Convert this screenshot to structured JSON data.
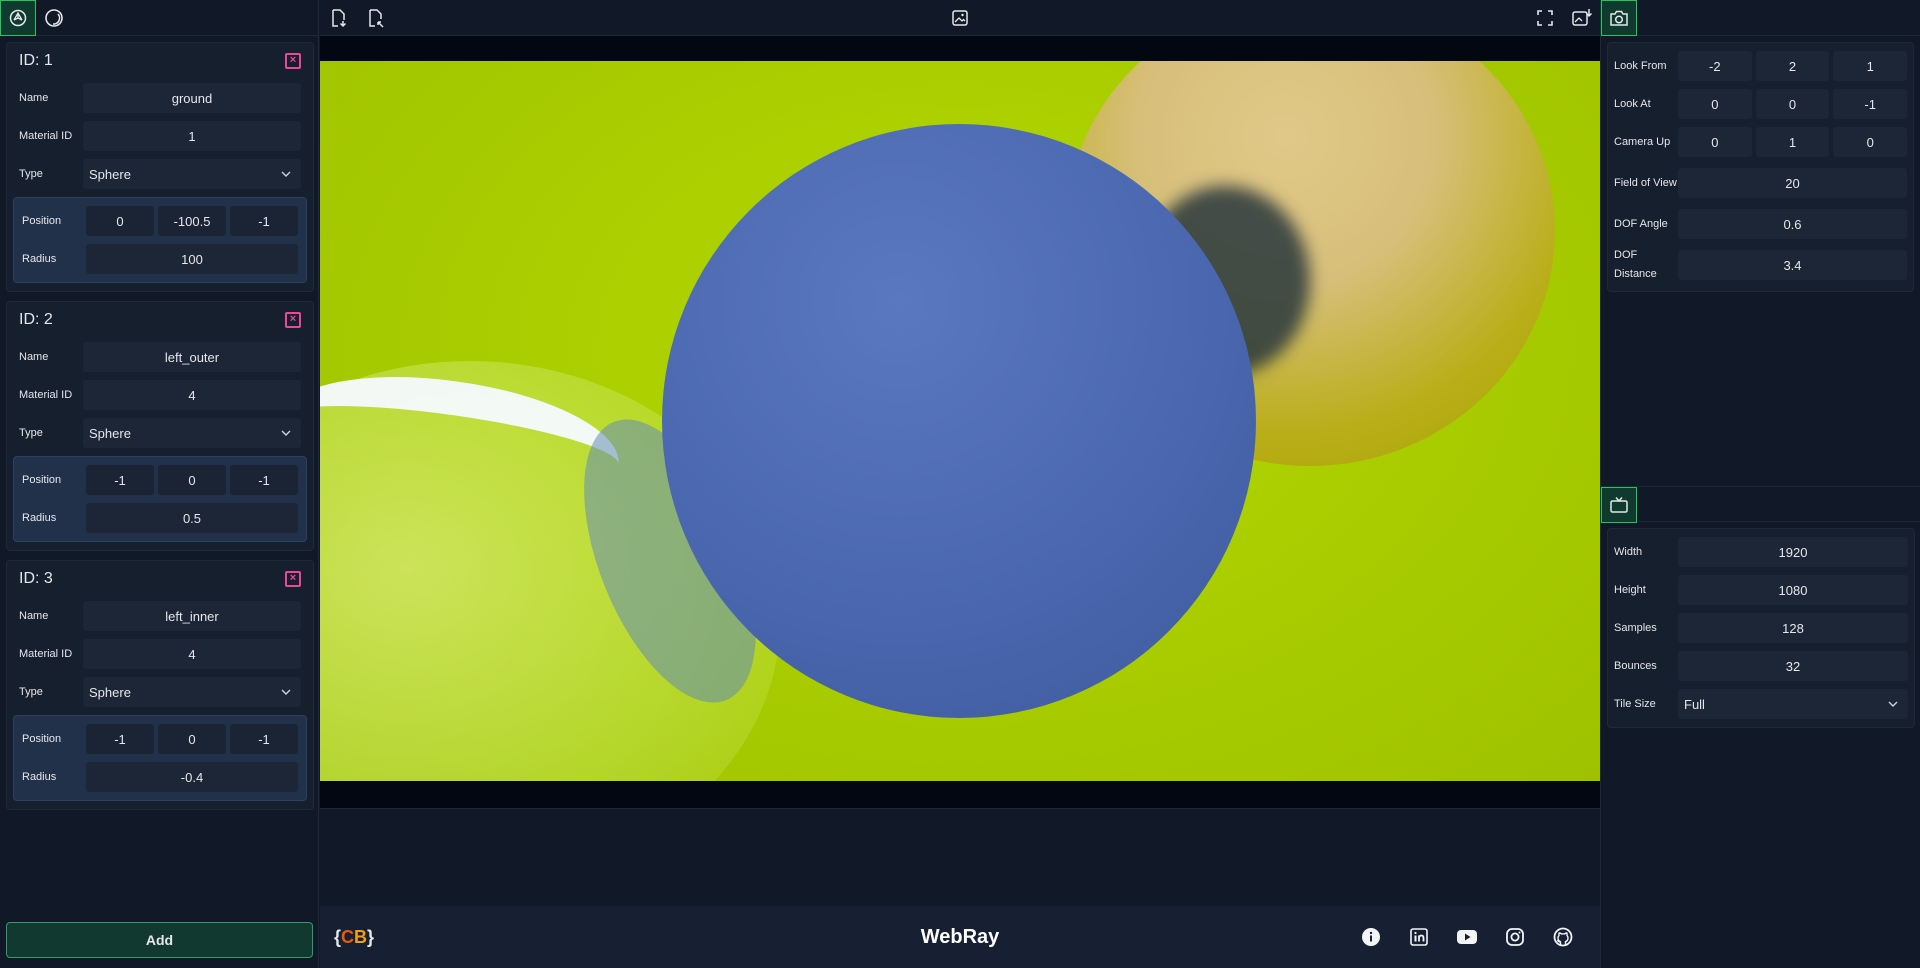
{
  "app": {
    "title": "WebRay",
    "brand": {
      "open": "{",
      "c": "C",
      "b": "B",
      "close": "}"
    }
  },
  "left_tabs": [
    {
      "icon": "scene-icon"
    },
    {
      "icon": "material-icon"
    }
  ],
  "objects": [
    {
      "title": "ID: 1",
      "name_label": "Name",
      "name": "ground",
      "material_label": "Material ID",
      "material": "1",
      "type_label": "Type",
      "type": "Sphere",
      "position_label": "Position",
      "position": [
        "0",
        "-100.5",
        "-1"
      ],
      "radius_label": "Radius",
      "radius": "100"
    },
    {
      "title": "ID: 2",
      "name_label": "Name",
      "name": "left_outer",
      "material_label": "Material ID",
      "material": "4",
      "type_label": "Type",
      "type": "Sphere",
      "position_label": "Position",
      "position": [
        "-1",
        "0",
        "-1"
      ],
      "radius_label": "Radius",
      "radius": "0.5"
    },
    {
      "title": "ID: 3",
      "name_label": "Name",
      "name": "left_inner",
      "material_label": "Material ID",
      "material": "4",
      "type_label": "Type",
      "type": "Sphere",
      "position_label": "Position",
      "position": [
        "-1",
        "0",
        "-1"
      ],
      "radius_label": "Radius",
      "radius": "-0.4"
    }
  ],
  "add_button": "Add",
  "camera": {
    "look_from_label": "Look From",
    "look_from": [
      "-2",
      "2",
      "1"
    ],
    "look_at_label": "Look At",
    "look_at": [
      "0",
      "0",
      "-1"
    ],
    "camera_up_label": "Camera Up",
    "camera_up": [
      "0",
      "1",
      "0"
    ],
    "fov_label": "Field of View",
    "fov": "20",
    "dof_angle_label": "DOF Angle",
    "dof_angle": "0.6",
    "dof_distance_label": "DOF Distance",
    "dof_distance": "3.4"
  },
  "render": {
    "width_label": "Width",
    "width": "1920",
    "height_label": "Height",
    "height": "1080",
    "samples_label": "Samples",
    "samples": "128",
    "bounces_label": "Bounces",
    "bounces": "32",
    "tile_label": "Tile Size",
    "tile": "Full"
  },
  "socials": [
    "info-icon",
    "linkedin-icon",
    "youtube-icon",
    "instagram-icon",
    "github-icon"
  ],
  "colors": {
    "accent": "#22c55e",
    "delete": "#ec4899",
    "scene_floor": "#b4d800"
  }
}
